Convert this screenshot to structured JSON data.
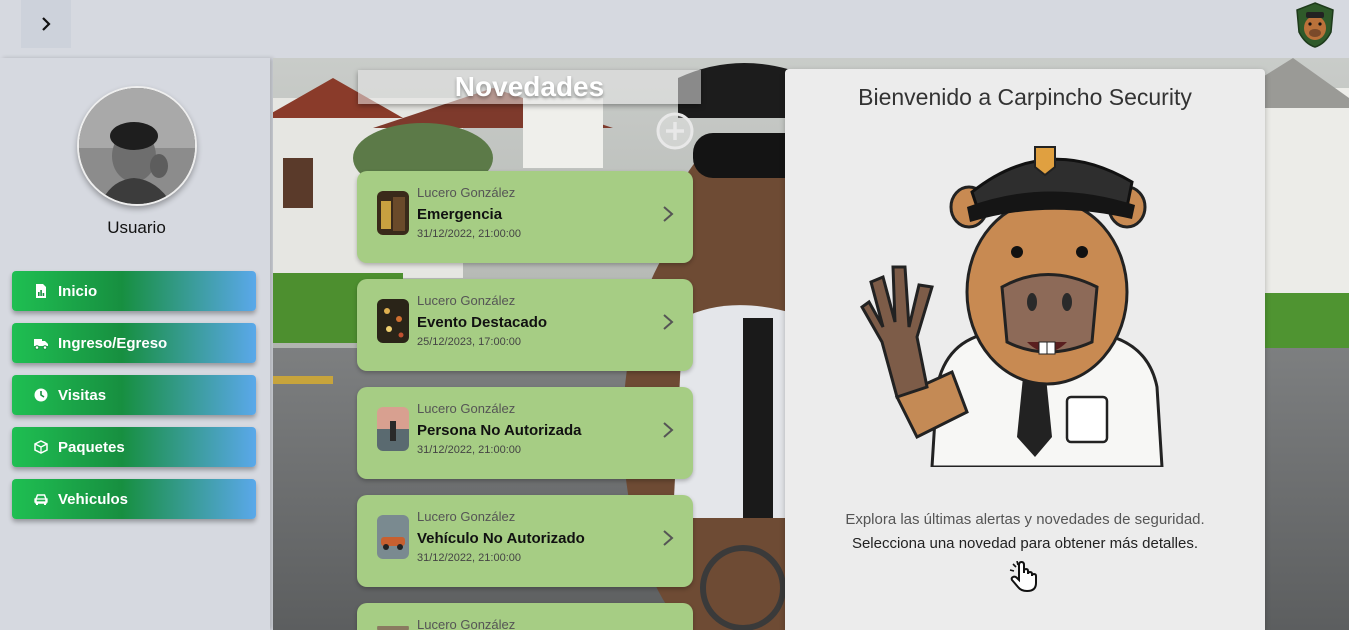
{
  "header": {
    "toggle_icon": "chevron-right-icon",
    "logo_icon": "carpincho-badge-icon"
  },
  "sidebar": {
    "user_label": "Usuario",
    "items": [
      {
        "label": "Inicio",
        "icon": "chart-file-icon"
      },
      {
        "label": "Ingreso/Egreso",
        "icon": "truck-icon"
      },
      {
        "label": "Visitas",
        "icon": "clock-icon"
      },
      {
        "label": "Paquetes",
        "icon": "box-icon"
      },
      {
        "label": "Vehiculos",
        "icon": "car-icon"
      }
    ]
  },
  "news": {
    "title": "Novedades",
    "add_icon": "plus-circle-icon",
    "cards": [
      {
        "author": "Lucero González",
        "title": "Emergencia",
        "date": "31/12/2022, 21:00:00"
      },
      {
        "author": "Lucero González",
        "title": "Evento Destacado",
        "date": "25/12/2023, 17:00:00"
      },
      {
        "author": "Lucero González",
        "title": "Persona No Autorizada",
        "date": "31/12/2022, 21:00:00"
      },
      {
        "author": "Lucero González",
        "title": "Vehículo No Autorizado",
        "date": "31/12/2022, 21:00:00"
      },
      {
        "author": "Lucero González",
        "title": "",
        "date": ""
      }
    ]
  },
  "welcome": {
    "title": "Bienvenido a Carpincho Security",
    "line1": "Explora las últimas alertas y novedades de seguridad.",
    "line2": "Selecciona una novedad para obtener más detalles.",
    "hand_icon": "pointing-hand-icon"
  },
  "colors": {
    "card_bg": "#a6cd84",
    "nav_start": "#1fbf52",
    "nav_end": "#5aa8ea",
    "panel_bg": "#ececec"
  }
}
